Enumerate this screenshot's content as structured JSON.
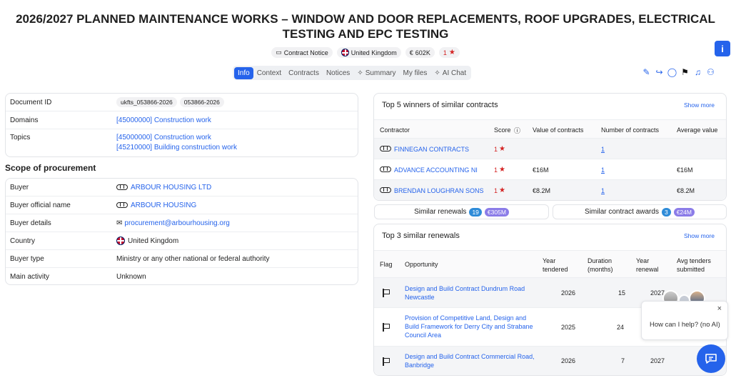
{
  "header": {
    "title": "2026/2027 PLANNED MAINTENANCE WORKS – WINDOW AND DOOR REPLACEMENTS, ROOF UPGRADES, ELECTRICAL TESTING AND EPC TESTING",
    "badges": {
      "type": "Contract Notice",
      "country": "United Kingdom",
      "value": "602K",
      "rating": "1"
    },
    "info_label": "i"
  },
  "tabs": [
    "Info",
    "Context",
    "Contracts",
    "Notices",
    "Summary",
    "My files",
    "AI Chat"
  ],
  "details": {
    "document_id_label": "Document ID",
    "document_ids": [
      "ukfts_053866-2026",
      "053866-2026"
    ],
    "domains_label": "Domains",
    "domains": [
      "[45000000] Construction work"
    ],
    "topics_label": "Topics",
    "topics": [
      "[45000000] Construction work",
      "[45210000] Building construction work"
    ]
  },
  "scope": {
    "heading": "Scope of procurement",
    "rows": [
      {
        "label": "Buyer",
        "value": "ARBOUR HOUSING LTD"
      },
      {
        "label": "Buyer official name",
        "value": "ARBOUR HOUSING"
      },
      {
        "label": "Buyer details",
        "value": "procurement@arbourhousing.org"
      },
      {
        "label": "Country",
        "value": "United Kingdom"
      },
      {
        "label": "Buyer type",
        "value": "Ministry or any other national or federal authority"
      },
      {
        "label": "Main activity",
        "value": "Unknown"
      }
    ]
  },
  "winners": {
    "title": "Top 5 winners of similar contracts",
    "show_more": "Show more",
    "columns": [
      "Contractor",
      "Score",
      "Value of contracts",
      "Number of contracts",
      "Average value"
    ],
    "rows": [
      {
        "name": "FINNEGAN CONTRACTS",
        "score": "1",
        "value": "",
        "count": "1",
        "avg": ""
      },
      {
        "name": "ADVANCE ACCOUNTING NI",
        "score": "1",
        "value": "€16M",
        "count": "1",
        "avg": "€16M"
      },
      {
        "name": "BRENDAN LOUGHRAN SONS",
        "score": "1",
        "value": "€8.2M",
        "count": "1",
        "avg": "€8.2M"
      }
    ]
  },
  "pills": {
    "renewals_label": "Similar renewals",
    "renewals_count": "19",
    "renewals_amount": "€305M",
    "awards_label": "Similar contract awards",
    "awards_count": "3",
    "awards_amount": "€24M"
  },
  "renewals": {
    "title": "Top 3 similar renewals",
    "show_more": "Show more",
    "columns": [
      "Flag",
      "Opportunity",
      "Year tendered",
      "Duration (months)",
      "Year renewal",
      "Avg tenders submitted"
    ],
    "rows": [
      {
        "opportunity": "Design and Build Contract Dundrum Road Newcastle",
        "year": "2026",
        "duration": "15",
        "renewal": "2027"
      },
      {
        "opportunity": "Provision of Competitive Land, Design and Build Framework for Derry City and Strabane Council Area",
        "year": "2025",
        "duration": "24",
        "renewal": ""
      },
      {
        "opportunity": "Design and Build Contract Commercial Road, Banbridge",
        "year": "2026",
        "duration": "7",
        "renewal": "2027"
      }
    ]
  },
  "chat": {
    "prompt": "How can I help? (no AI)",
    "close": "×"
  }
}
